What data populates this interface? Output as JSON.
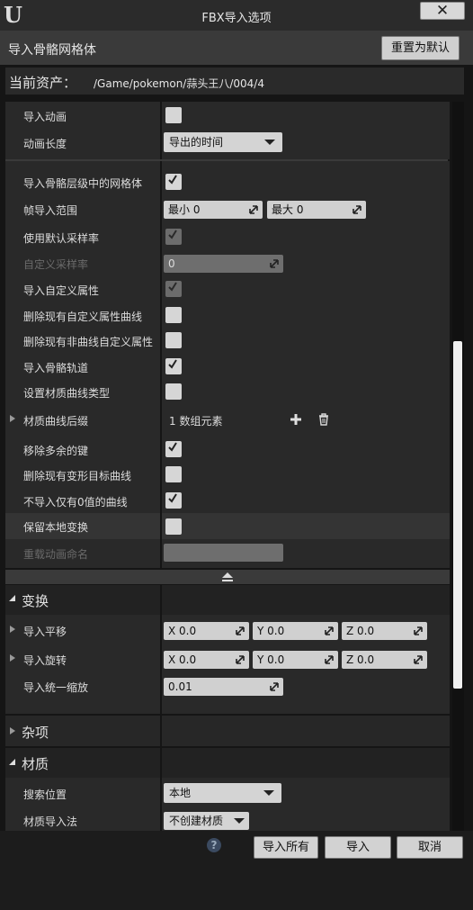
{
  "window": {
    "title": "FBX导入选项",
    "logo": "U",
    "close_label": "✕"
  },
  "header": {
    "title": "导入骨骼网格体",
    "reset_label": "重置为默认"
  },
  "asset": {
    "label": "当前资产：",
    "path": "/Game/pokemon/蒜头王八/004/4"
  },
  "animation": {
    "import_animation": "导入动画",
    "anim_length": "动画长度",
    "anim_length_value": "导出的时间",
    "import_meshes_in_bone_hierarchy": "导入骨骼层级中的网格体",
    "frame_import_range": "帧导入范围",
    "range_min": "最小 0",
    "range_max": "最大 0",
    "use_default_sample_rate": "使用默认采样率",
    "custom_sample_rate": "自定义采样率",
    "custom_sample_rate_value": "0",
    "import_custom_attribute": "导入自定义属性",
    "delete_existing_custom_attr_curves": "删除现有自定义属性曲线",
    "delete_existing_non_curve_custom_attr": "删除现有非曲线自定义属性",
    "import_bone_tracks": "导入骨骼轨道",
    "set_material_curve_type": "设置材质曲线类型",
    "material_curve_suffixes": "材质曲线后缀",
    "material_curve_suffixes_value": "1 数组元素",
    "remove_redundant_keys": "移除多余的键",
    "delete_existing_morph_target_curves": "删除现有变形目标曲线",
    "do_not_import_curve_with_zero": "不导入仅有0值的曲线",
    "preserve_local_transform": "保留本地变换",
    "override_animation_name": "重载动画命名"
  },
  "transform": {
    "section_label": "变换",
    "import_translation": "导入平移",
    "import_rotation": "导入旋转",
    "import_uniform_scale": "导入统一缩放",
    "tx": "X  0.0",
    "ty": "Y  0.0",
    "tz": "Z  0.0",
    "rx": "X  0.0",
    "ry": "Y  0.0",
    "rz": "Z  0.0",
    "scale": "0.01"
  },
  "misc": {
    "section_label": "杂项"
  },
  "material": {
    "section_label": "材质",
    "search_location": "搜索位置",
    "search_location_value": "本地",
    "material_import_method": "材质导入法",
    "material_import_method_value": "不创建材质"
  },
  "footer": {
    "import_all": "导入所有",
    "import": "导入",
    "cancel": "取消",
    "help_glyph": "?"
  },
  "colors": {
    "panel": "#292929",
    "background": "#151515",
    "button": "#d2d2d2"
  }
}
